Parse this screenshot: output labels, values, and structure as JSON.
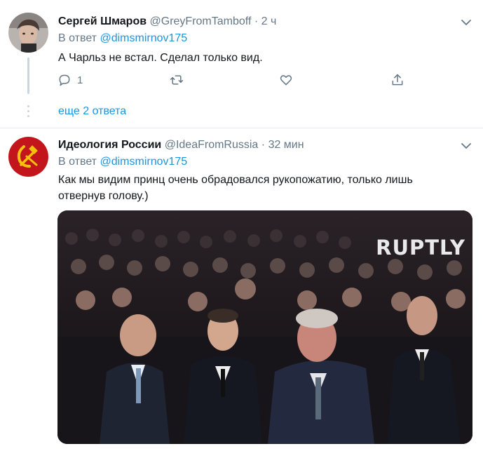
{
  "tweets": [
    {
      "name": "Сергей Шмаров",
      "handle": "@GreyFromTamboff",
      "dot": "·",
      "time": "2 ч",
      "reply_prefix": "В ответ",
      "reply_handle": "@dimsmirnov175",
      "text": "А Чарльз не встал. Сделал только вид.",
      "actions": {
        "reply_count": "1"
      },
      "more_replies": "еще 2 ответа"
    },
    {
      "name": "Идеология России",
      "handle": "@IdeaFromRussia",
      "dot": "·",
      "time": "32 мин",
      "reply_prefix": "В ответ",
      "reply_handle": "@dimsmirnov175",
      "text_line1": "Как мы видим принц очень обрадовался рукопожатию, только лишь",
      "text_line2": "отвернув голову.)",
      "media_watermark": "RUPTLY"
    }
  ],
  "icons": {
    "reply": "reply-icon",
    "retweet": "retweet-icon",
    "like": "like-icon",
    "share": "share-icon",
    "more": "chevron-down-icon"
  },
  "colors": {
    "link": "#1b95e0",
    "muted": "#657786",
    "thread_line": "#ccd6dd",
    "divider": "#e6ecf0",
    "soviet_red": "#c3161c",
    "soviet_gold": "#f4c20d"
  }
}
